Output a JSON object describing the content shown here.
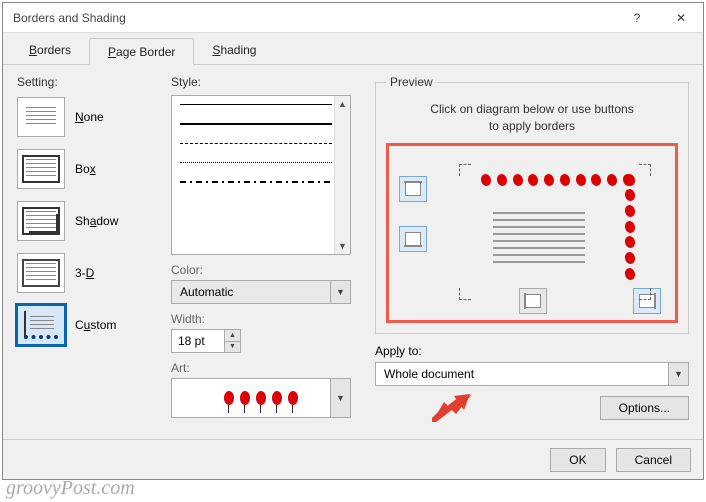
{
  "title": "Borders and Shading",
  "titlebar": {
    "help": "?",
    "close": "✕"
  },
  "tabs": {
    "borders": "Borders",
    "page_border": "Page Border",
    "shading": "Shading"
  },
  "setting": {
    "label": "Setting:",
    "none": "None",
    "box": "Box",
    "shadow": "Shadow",
    "threed": "3-D",
    "custom": "Custom"
  },
  "style": {
    "label": "Style:",
    "color_label": "Color:",
    "color_value": "Automatic",
    "width_label": "Width:",
    "width_value": "18 pt",
    "art_label": "Art:"
  },
  "preview": {
    "legend": "Preview",
    "hint1": "Click on diagram below or use buttons",
    "hint2": "to apply borders"
  },
  "apply": {
    "label": "Apply to:",
    "value": "Whole document"
  },
  "buttons": {
    "options": "Options...",
    "ok": "OK",
    "cancel": "Cancel"
  },
  "watermark": "groovyPost.com"
}
